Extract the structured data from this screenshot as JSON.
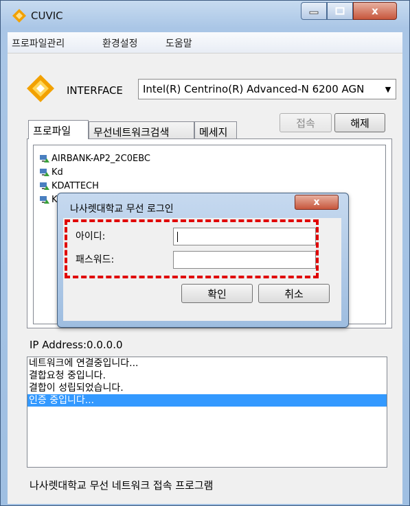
{
  "window": {
    "title": "CUVIC",
    "close_glyph": "x"
  },
  "menu": [
    "프로파일관리",
    "환경설정",
    "도움말"
  ],
  "interface": {
    "label": "INTERFACE",
    "selected": "Intel(R) Centrino(R) Advanced-N 6200 AGN"
  },
  "buttons": {
    "connect": "접속",
    "disconnect": "해제"
  },
  "tabs": [
    "프로파일",
    "무선네트워크검색",
    "메세지"
  ],
  "networks": [
    "AIRBANK-AP2_2C0EBC",
    "Kd",
    "KDATTECH",
    "K"
  ],
  "ip_address": "IP Address:0.0.0.0",
  "log": [
    "네트워크에 연결중입니다...",
    "결합요청 중입니다.",
    "결합이 성립되었습니다.",
    "인증 중입니다..."
  ],
  "footer": "나사렛대학교 무선 네트워크 접속 프로그램",
  "login_dialog": {
    "title": "나사렛대학교 무선 로그인",
    "close_glyph": "x",
    "id_label": "아이디:",
    "id_value": "",
    "password_label": "패스워드:",
    "password_value": "",
    "ok": "확인",
    "cancel": "취소"
  },
  "colors": {
    "selection": "#3399ff",
    "highlight_dash": "#e00000",
    "logo_orange": "#f2a100"
  }
}
